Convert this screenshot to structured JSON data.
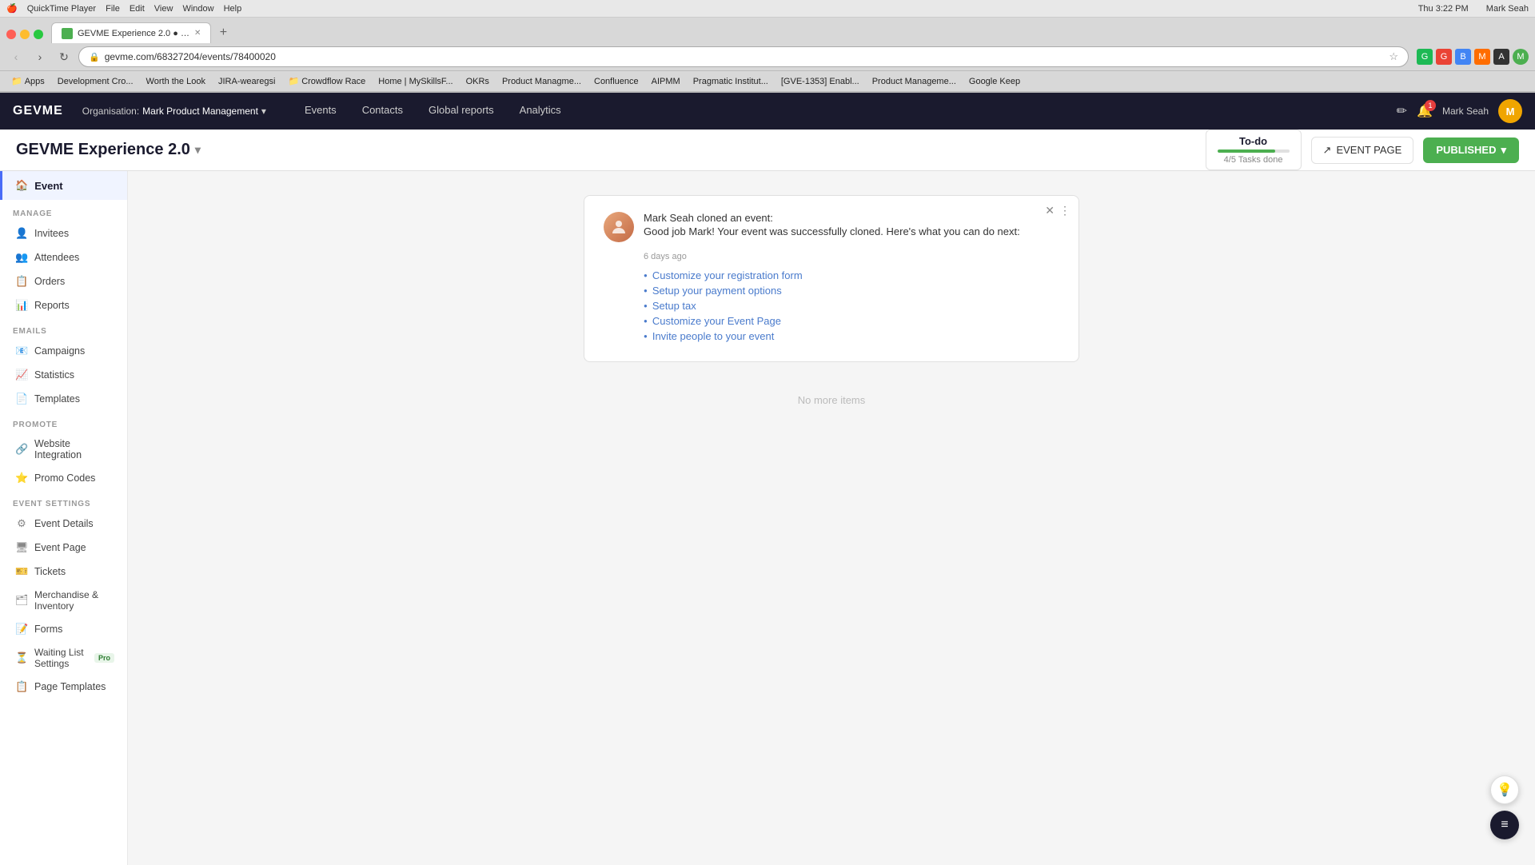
{
  "macbar": {
    "left": [
      "🍎",
      "QuickTime Player",
      "File",
      "Edit",
      "View",
      "Window",
      "Help"
    ],
    "right": "Thu 3:22 PM   Mark Seah",
    "time": "Thu 3:22 PM",
    "user": "Mark Seah"
  },
  "browser": {
    "tab_title": "GEVME Experience 2.0 ● GEV...",
    "url": "gevme.com/68327204/events/78400020",
    "bookmarks": [
      {
        "label": "Apps",
        "type": "folder"
      },
      {
        "label": "Development Cro...",
        "type": "link"
      },
      {
        "label": "Worth the Look",
        "type": "link"
      },
      {
        "label": "JIRA-wearegsi",
        "type": "link"
      },
      {
        "label": "Crowdflow Race",
        "type": "folder"
      },
      {
        "label": "Home | MySkillsF...",
        "type": "link"
      },
      {
        "label": "OKRs",
        "type": "link"
      },
      {
        "label": "Product Managme...",
        "type": "link"
      },
      {
        "label": "Confluence",
        "type": "link"
      },
      {
        "label": "AIPMM",
        "type": "link"
      },
      {
        "label": "Pragmatic Institut...",
        "type": "link"
      },
      {
        "label": "[GVE-1353] Enabl...",
        "type": "link"
      },
      {
        "label": "Product Manageme...",
        "type": "link"
      },
      {
        "label": "Google Keep",
        "type": "link"
      }
    ]
  },
  "gevme_nav": {
    "logo": "GEVME",
    "org_label": "Organisation:",
    "org_name": "Mark Product Management",
    "nav_links": [
      {
        "label": "Events",
        "active": false
      },
      {
        "label": "Contacts",
        "active": false
      },
      {
        "label": "Global reports",
        "active": false
      },
      {
        "label": "Analytics",
        "active": false
      }
    ],
    "notification_count": "1",
    "user_name": "Mark Seah",
    "user_initial": "M"
  },
  "event_header": {
    "title": "GEVME Experience 2.0",
    "todo_label": "To-do",
    "todo_tasks": "4/5 Tasks done",
    "todo_progress": 80,
    "event_page_btn": "EVENT PAGE",
    "published_btn": "PUBLISHED"
  },
  "sidebar": {
    "event_label": "Event",
    "sections": [
      {
        "title": "MANAGE",
        "items": [
          {
            "label": "Invitees",
            "icon": "👤"
          },
          {
            "label": "Attendees",
            "icon": "👥"
          },
          {
            "label": "Orders",
            "icon": "📋"
          },
          {
            "label": "Reports",
            "icon": "📊"
          }
        ]
      },
      {
        "title": "EMAILS",
        "items": [
          {
            "label": "Campaigns",
            "icon": "📧"
          },
          {
            "label": "Statistics",
            "icon": "📈"
          },
          {
            "label": "Templates",
            "icon": "📄"
          }
        ]
      },
      {
        "title": "PROMOTE",
        "items": [
          {
            "label": "Website Integration",
            "icon": "🔗"
          },
          {
            "label": "Promo Codes",
            "icon": "⭐"
          }
        ]
      },
      {
        "title": "EVENT SETTINGS",
        "items": [
          {
            "label": "Event Details",
            "icon": "⚙"
          },
          {
            "label": "Event Page",
            "icon": "🖥"
          },
          {
            "label": "Tickets",
            "icon": "🎫"
          },
          {
            "label": "Merchandise & Inventory",
            "icon": "🗂"
          },
          {
            "label": "Forms",
            "icon": "📝"
          },
          {
            "label": "Waiting List Settings",
            "icon": "⏳",
            "badge": "Pro"
          },
          {
            "label": "Page Templates",
            "icon": "📋"
          }
        ]
      }
    ]
  },
  "notification": {
    "actor": "Mark Seah",
    "action": "cloned an event:",
    "title": "Mark Seah cloned an event:",
    "body": "Good job Mark! Your event was successfully cloned. Here's what you can do next:",
    "time": "6 days ago",
    "links": [
      {
        "text": "Customize your registration form"
      },
      {
        "text": "Setup your payment options"
      },
      {
        "text": "Setup tax"
      },
      {
        "text": "Customize your Event Page"
      },
      {
        "text": "Invite people to your event"
      }
    ]
  },
  "no_more_items": "No more items"
}
